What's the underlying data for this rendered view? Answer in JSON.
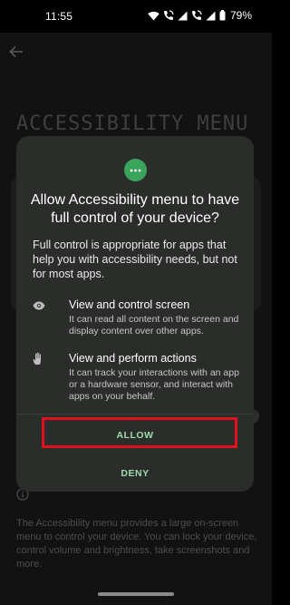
{
  "status_bar": {
    "time": "11:55",
    "battery": "79%",
    "icons": [
      "wifi-icon",
      "wifi-calling-icon",
      "signal-icon",
      "wifi-calling-icon",
      "signal-icon",
      "battery-icon"
    ]
  },
  "background_page": {
    "title": "ACCESSIBILITY MENU",
    "description": "The Accessibility menu provides a large on-screen menu to control your device. You can lock your device, control volume and brightness, take screenshots and more."
  },
  "dialog": {
    "icon": "more-dots-icon",
    "title": "Allow Accessibility menu to have full control of your device?",
    "text": "Full control is appropriate for apps that help you with accessibility needs, but not for most apps.",
    "permissions": [
      {
        "icon": "eye-icon",
        "title": "View and control screen",
        "description": "It can read all content on the screen and display content over other apps."
      },
      {
        "icon": "hand-icon",
        "title": "View and perform actions",
        "description": "It can track your interactions with an app or a hardware sensor, and interact with apps on your behalf."
      }
    ],
    "allow_label": "ALLOW",
    "deny_label": "DENY"
  },
  "colors": {
    "accent_button_text": "#9fdbab",
    "dialog_icon_bg": "#3aa45b",
    "highlight_border": "#e0101c"
  }
}
